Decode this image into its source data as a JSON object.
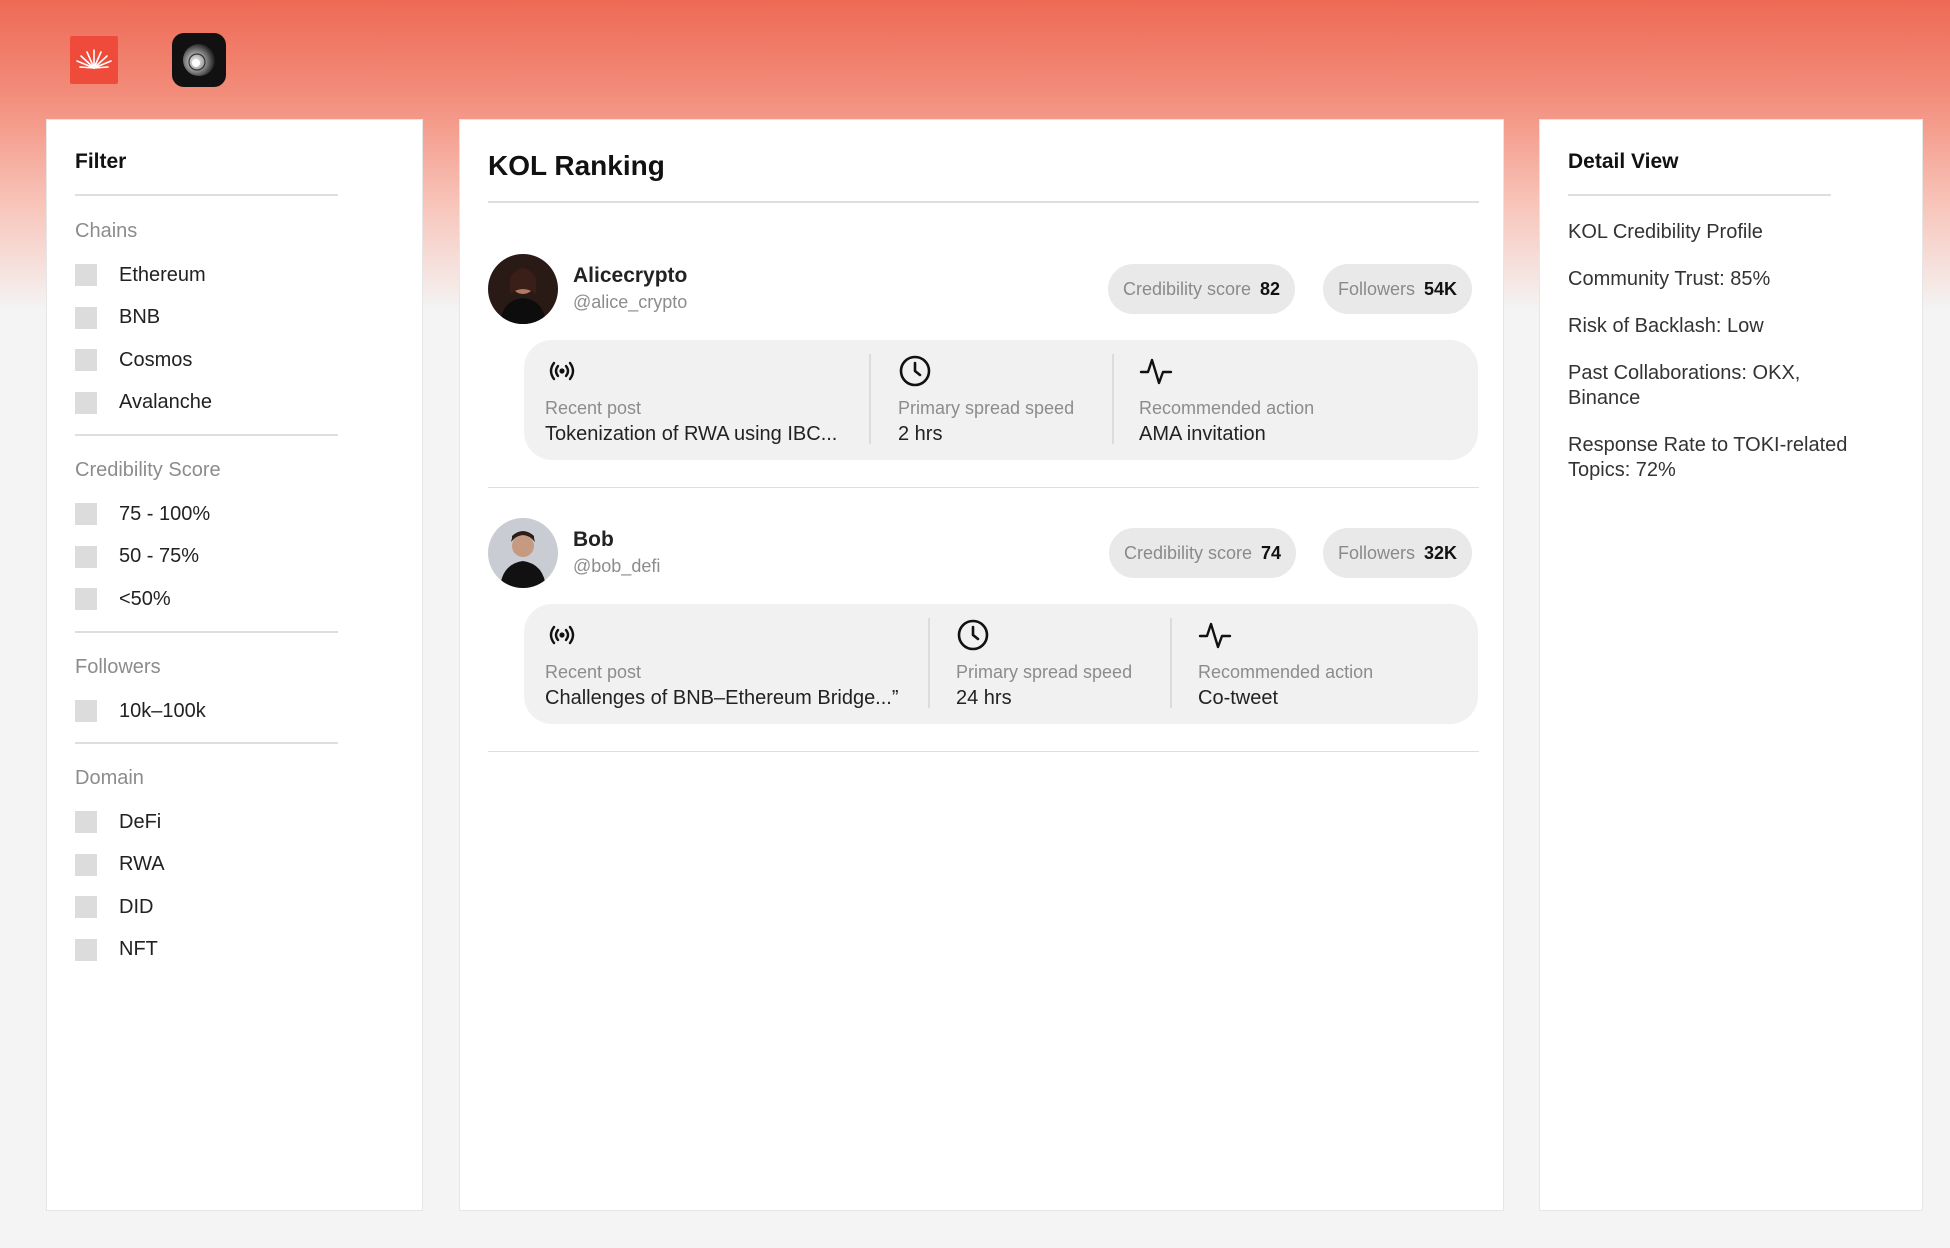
{
  "logos": {
    "brand_logo": "brand-logo",
    "app_logo": "app-logo"
  },
  "filter": {
    "title": "Filter",
    "groups": [
      {
        "title": "Chains",
        "options": [
          "Ethereum",
          "BNB",
          "Cosmos",
          "Avalanche"
        ]
      },
      {
        "title": "Credibility Score",
        "options": [
          "75 - 100%",
          "50 - 75%",
          "<50%"
        ]
      },
      {
        "title": "Followers",
        "options": [
          "10k–100k"
        ]
      },
      {
        "title": "Domain",
        "options": [
          "DeFi",
          "RWA",
          "DID",
          "NFT"
        ]
      }
    ]
  },
  "ranking": {
    "title": "KOL Ranking",
    "kols": [
      {
        "name": "Alicecrypto",
        "handle": "@alice_crypto",
        "credibility_label": "Credibility score",
        "credibility_value": "82",
        "followers_label": "Followers",
        "followers_value": "54K",
        "recent_post_label": "Recent post",
        "recent_post": "Tokenization of RWA using IBC...",
        "spread_label": "Primary spread speed",
        "spread": "2 hrs",
        "action_label": "Recommended action",
        "action": "AMA invitation"
      },
      {
        "name": "Bob",
        "handle": "@bob_defi",
        "credibility_label": "Credibility score",
        "credibility_value": "74",
        "followers_label": "Followers",
        "followers_value": "32K",
        "recent_post_label": "Recent post",
        "recent_post": "Challenges of BNB–Ethereum Bridge...”",
        "spread_label": "Primary spread speed",
        "spread": "24 hrs",
        "action_label": "Recommended action",
        "action": "Co-tweet"
      }
    ]
  },
  "detail": {
    "title": "Detail View",
    "lines": [
      "KOL Credibility Profile",
      "Community Trust: 85%",
      "Risk of Backlash: Low",
      "Past Collaborations: OKX, Binance",
      "Response Rate to TOKI-related Topics: 72%"
    ]
  },
  "colors": {
    "accent": "#ee6a55",
    "panel": "#ffffff",
    "pill": "#e9e9e9",
    "card": "#f1f1f1"
  }
}
